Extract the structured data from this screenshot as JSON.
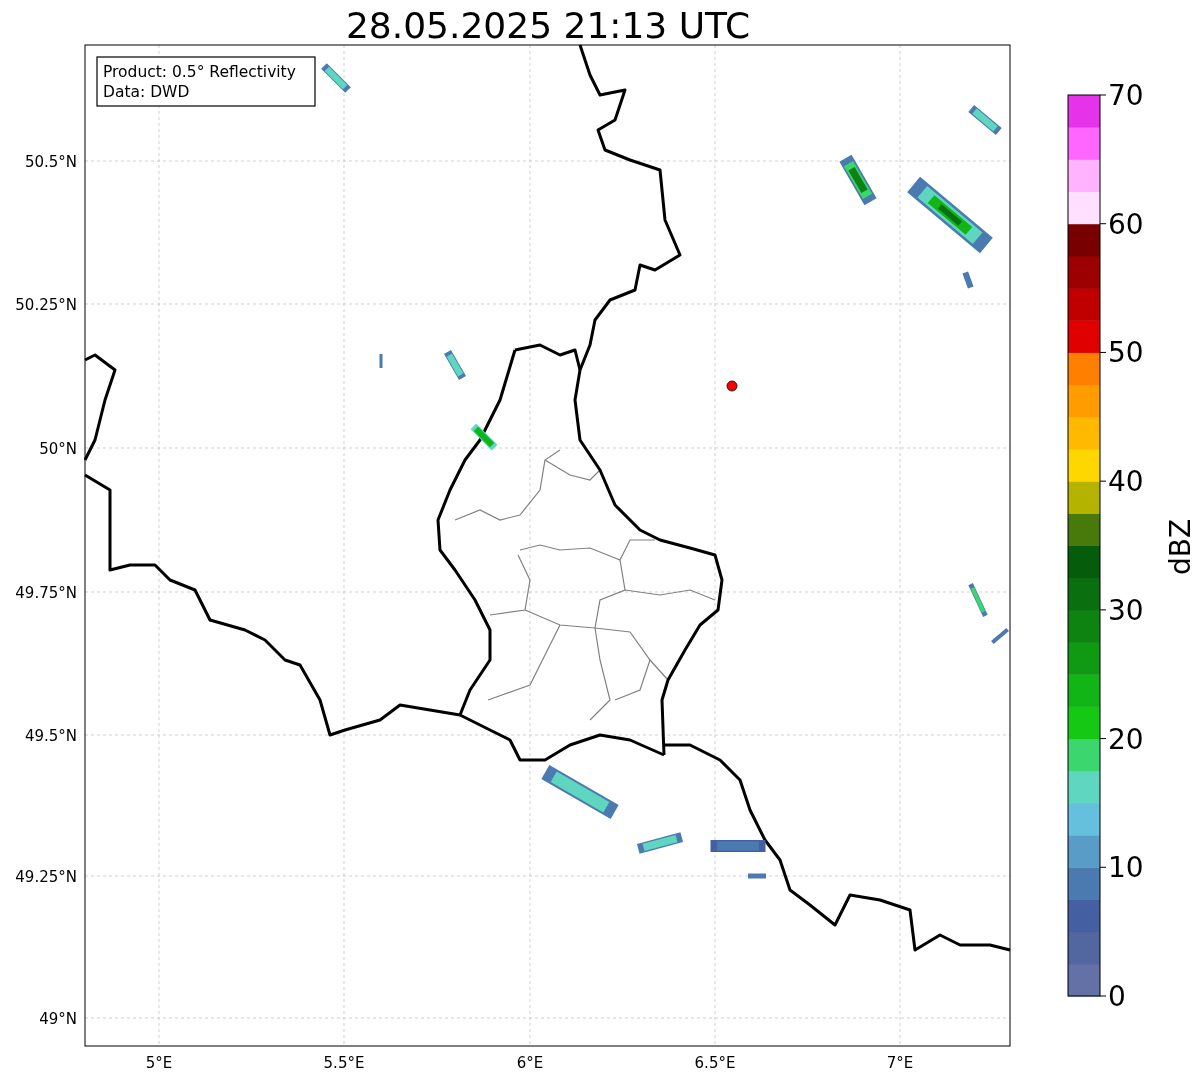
{
  "title": "28.05.2025 21:13 UTC",
  "info_box": {
    "lines": [
      "Product: 0.5° Reflectivity",
      "Data: DWD"
    ]
  },
  "y_ticks": [
    "50.5°N",
    "50.25°N",
    "50°N",
    "49.75°N",
    "49.5°N",
    "49.25°N",
    "49°N"
  ],
  "x_ticks": [
    "5°E",
    "5.5°E",
    "6°E",
    "6.5°E",
    "7°E"
  ],
  "colorbar": {
    "label": "dBZ",
    "ticks": [
      "70",
      "60",
      "50",
      "40",
      "30",
      "20",
      "10",
      "0"
    ],
    "segments": [
      {
        "color": "#6371a6"
      },
      {
        "color": "#5266a0"
      },
      {
        "color": "#4460a2"
      },
      {
        "color": "#4a7ab0"
      },
      {
        "color": "#5a9cc8"
      },
      {
        "color": "#64c0dc"
      },
      {
        "color": "#5fd7c0"
      },
      {
        "color": "#3cd66e"
      },
      {
        "color": "#14c814"
      },
      {
        "color": "#11b515"
      },
      {
        "color": "#109a14"
      },
      {
        "color": "#0e8312"
      },
      {
        "color": "#0a700f"
      },
      {
        "color": "#055c0a"
      },
      {
        "color": "#477a0a"
      },
      {
        "color": "#b3b300"
      },
      {
        "color": "#ffd700"
      },
      {
        "color": "#ffb900"
      },
      {
        "color": "#ff9c00"
      },
      {
        "color": "#ff7f00"
      },
      {
        "color": "#e00000"
      },
      {
        "color": "#c00000"
      },
      {
        "color": "#9c0000"
      },
      {
        "color": "#780000"
      },
      {
        "color": "#ffe0ff"
      },
      {
        "color": "#ffb3ff"
      },
      {
        "color": "#ff66ff"
      },
      {
        "color": "#e633e9"
      }
    ]
  }
}
